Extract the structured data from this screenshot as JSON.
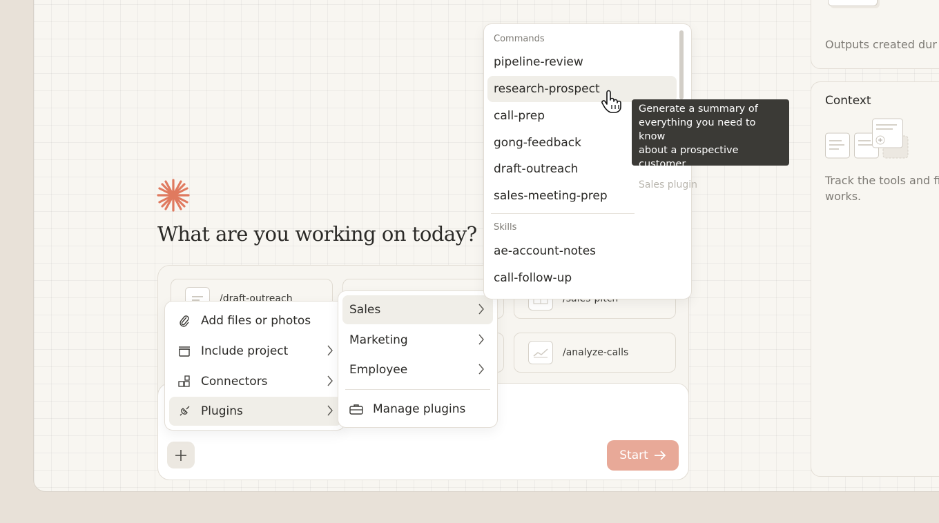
{
  "colors": {
    "accent": "#e07a5f",
    "start_button": "#e8a998",
    "tooltip_bg": "#3b3a36"
  },
  "right_panel": {
    "outputs_text": "Outputs created dur",
    "context_title": "Context",
    "context_text_line1": "Track the tools and fi",
    "context_text_line2": "works."
  },
  "main": {
    "headline": "What are you working on today?",
    "start_label": "Start",
    "quick_actions": [
      {
        "label": "/draft-outreach",
        "icon": "chat-icon"
      },
      {
        "label": "/sales-pitch",
        "icon": "table-icon"
      },
      {
        "label": "/analyze-calls",
        "icon": "chart-icon"
      }
    ]
  },
  "attach_menu": {
    "items": [
      {
        "label": "Add files or photos",
        "icon": "paperclip-icon"
      },
      {
        "label": "Include project",
        "icon": "box-icon"
      },
      {
        "label": "Connectors",
        "icon": "connectors-icon"
      },
      {
        "label": "Plugins",
        "icon": "plug-icon"
      }
    ]
  },
  "plugins_menu": {
    "items": [
      {
        "label": "Sales"
      },
      {
        "label": "Marketing"
      },
      {
        "label": "Employee"
      }
    ],
    "manage_label": "Manage plugins"
  },
  "commands_menu": {
    "commands_heading": "Commands",
    "commands": [
      "pipeline-review",
      "research-prospect",
      "call-prep",
      "gong-feedback",
      "draft-outreach",
      "sales-meeting-prep"
    ],
    "skills_heading": "Skills",
    "skills": [
      "ae-account-notes",
      "call-follow-up"
    ]
  },
  "tooltip": {
    "line1": "Generate a summary of",
    "line2": "everything you need to know",
    "line3": "about a prospective customer.",
    "source": "Sales plugin"
  }
}
